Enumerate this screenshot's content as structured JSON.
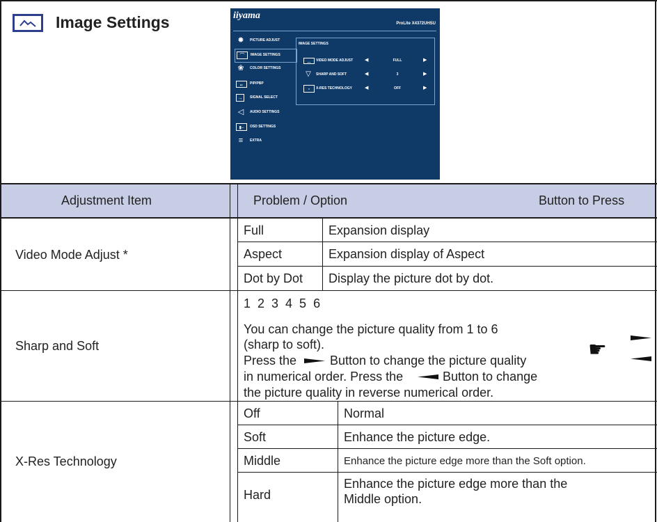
{
  "section": {
    "title": "Image Settings",
    "icon": "image-icon"
  },
  "osd": {
    "brand": "iiyama",
    "model": "ProLite X4372UHSU",
    "menu": [
      {
        "icon": "sun-icon",
        "label": "PICTURE ADJUST",
        "selected": false
      },
      {
        "icon": "image-icon",
        "label": "IMAGE SETTINGS",
        "selected": true
      },
      {
        "icon": "color-icon",
        "label": "COLOR SETTINGS",
        "selected": false
      },
      {
        "icon": "pip-icon",
        "label": "PIP/PBP",
        "selected": false
      },
      {
        "icon": "input-icon",
        "label": "SIGNAL SELECT",
        "selected": false
      },
      {
        "icon": "speaker-icon",
        "label": "AUDIO SETTINGS",
        "selected": false
      },
      {
        "icon": "osd-icon",
        "label": "OSD SETTINGS",
        "selected": false
      },
      {
        "icon": "sliders-icon",
        "label": "EXTRA",
        "selected": false
      }
    ],
    "panel_title": "IMAGE SETTINGS",
    "rows": [
      {
        "icon": "video-mode-icon",
        "label": "VIDEO MODE ADJUST",
        "value": "FULL"
      },
      {
        "icon": "sharp-icon",
        "label": "SHARP AND SOFT",
        "value": "3"
      },
      {
        "icon": "xres-icon",
        "label": "X-RES TECHNOLOGY",
        "value": "OFF"
      }
    ]
  },
  "table": {
    "header": {
      "item": "Adjustment Item",
      "problem": "Problem / Option",
      "button": "Button to Press"
    },
    "video_mode": {
      "item": "Video Mode Adjust *",
      "options": [
        {
          "option": "Full",
          "desc": "Expansion display"
        },
        {
          "option": "Aspect",
          "desc": "Expansion display of Aspect"
        },
        {
          "option": "Dot by Dot",
          "desc": "Display the picture dot by dot."
        }
      ]
    },
    "sharp_soft": {
      "item": "Sharp and Soft",
      "values": "1  2  3  4  5  6",
      "line1": "You can change the picture quality from 1 to 6",
      "line2": "(sharp to soft).",
      "line3a": "Press the",
      "line3b": "Button to change the picture quality",
      "line4a": "in numerical order. Press the",
      "line4b": "Button to change",
      "line5": "the picture quality in reverse numerical order."
    },
    "xres": {
      "item": "X-Res Technology",
      "options": [
        {
          "option": "Off",
          "desc": "Normal"
        },
        {
          "option": "Soft",
          "desc": "Enhance the picture edge."
        },
        {
          "option": "Middle",
          "desc": "Enhance the picture edge more than the Soft option."
        },
        {
          "option": "Hard",
          "desc": "Enhance the picture edge more than the",
          "desc2": "Middle option."
        }
      ]
    }
  }
}
